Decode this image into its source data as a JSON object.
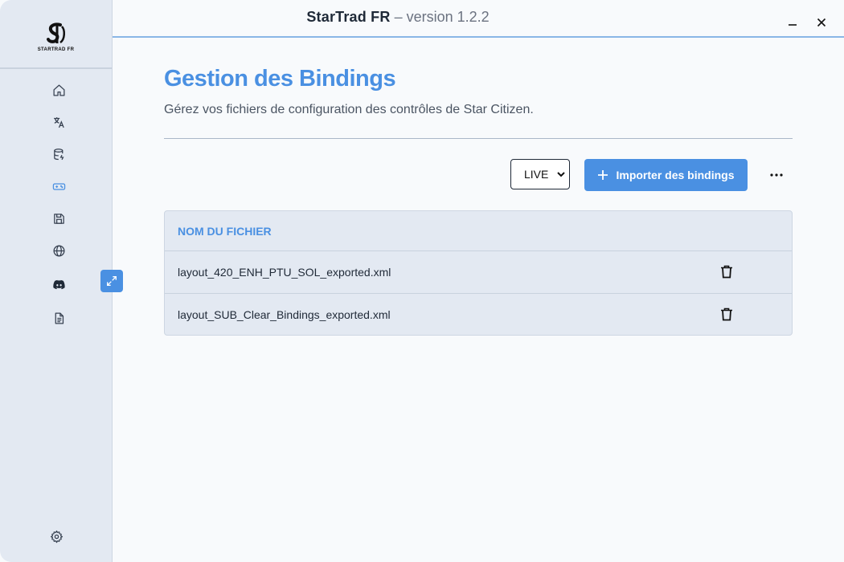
{
  "app": {
    "name": "StarTrad FR",
    "version_text": "– version 1.2.2",
    "logo_text": "STARTRAD FR"
  },
  "sidebar": {
    "items": [
      {
        "icon": "home-icon"
      },
      {
        "icon": "translate-icon"
      },
      {
        "icon": "database-icon"
      },
      {
        "icon": "gamepad-icon",
        "active": true
      },
      {
        "icon": "save-icon"
      },
      {
        "icon": "globe-icon"
      },
      {
        "icon": "discord-icon"
      },
      {
        "icon": "document-icon"
      }
    ],
    "settings_icon": "gear-icon",
    "expand_icon": "expand-icon"
  },
  "page": {
    "title": "Gestion des Bindings",
    "subtitle": "Gérez vos fichiers de configuration des contrôles de Star Citizen."
  },
  "toolbar": {
    "environment_selected": "LIVE",
    "import_label": "Importer des bindings"
  },
  "table": {
    "header": "NOM DU FICHIER",
    "rows": [
      {
        "filename": "layout_420_ENH_PTU_SOL_exported.xml"
      },
      {
        "filename": "layout_SUB_Clear_Bindings_exported.xml"
      }
    ]
  },
  "colors": {
    "accent": "#4a90e2",
    "sidebar_bg": "#e3e9f2",
    "content_bg": "#f8fafc"
  }
}
